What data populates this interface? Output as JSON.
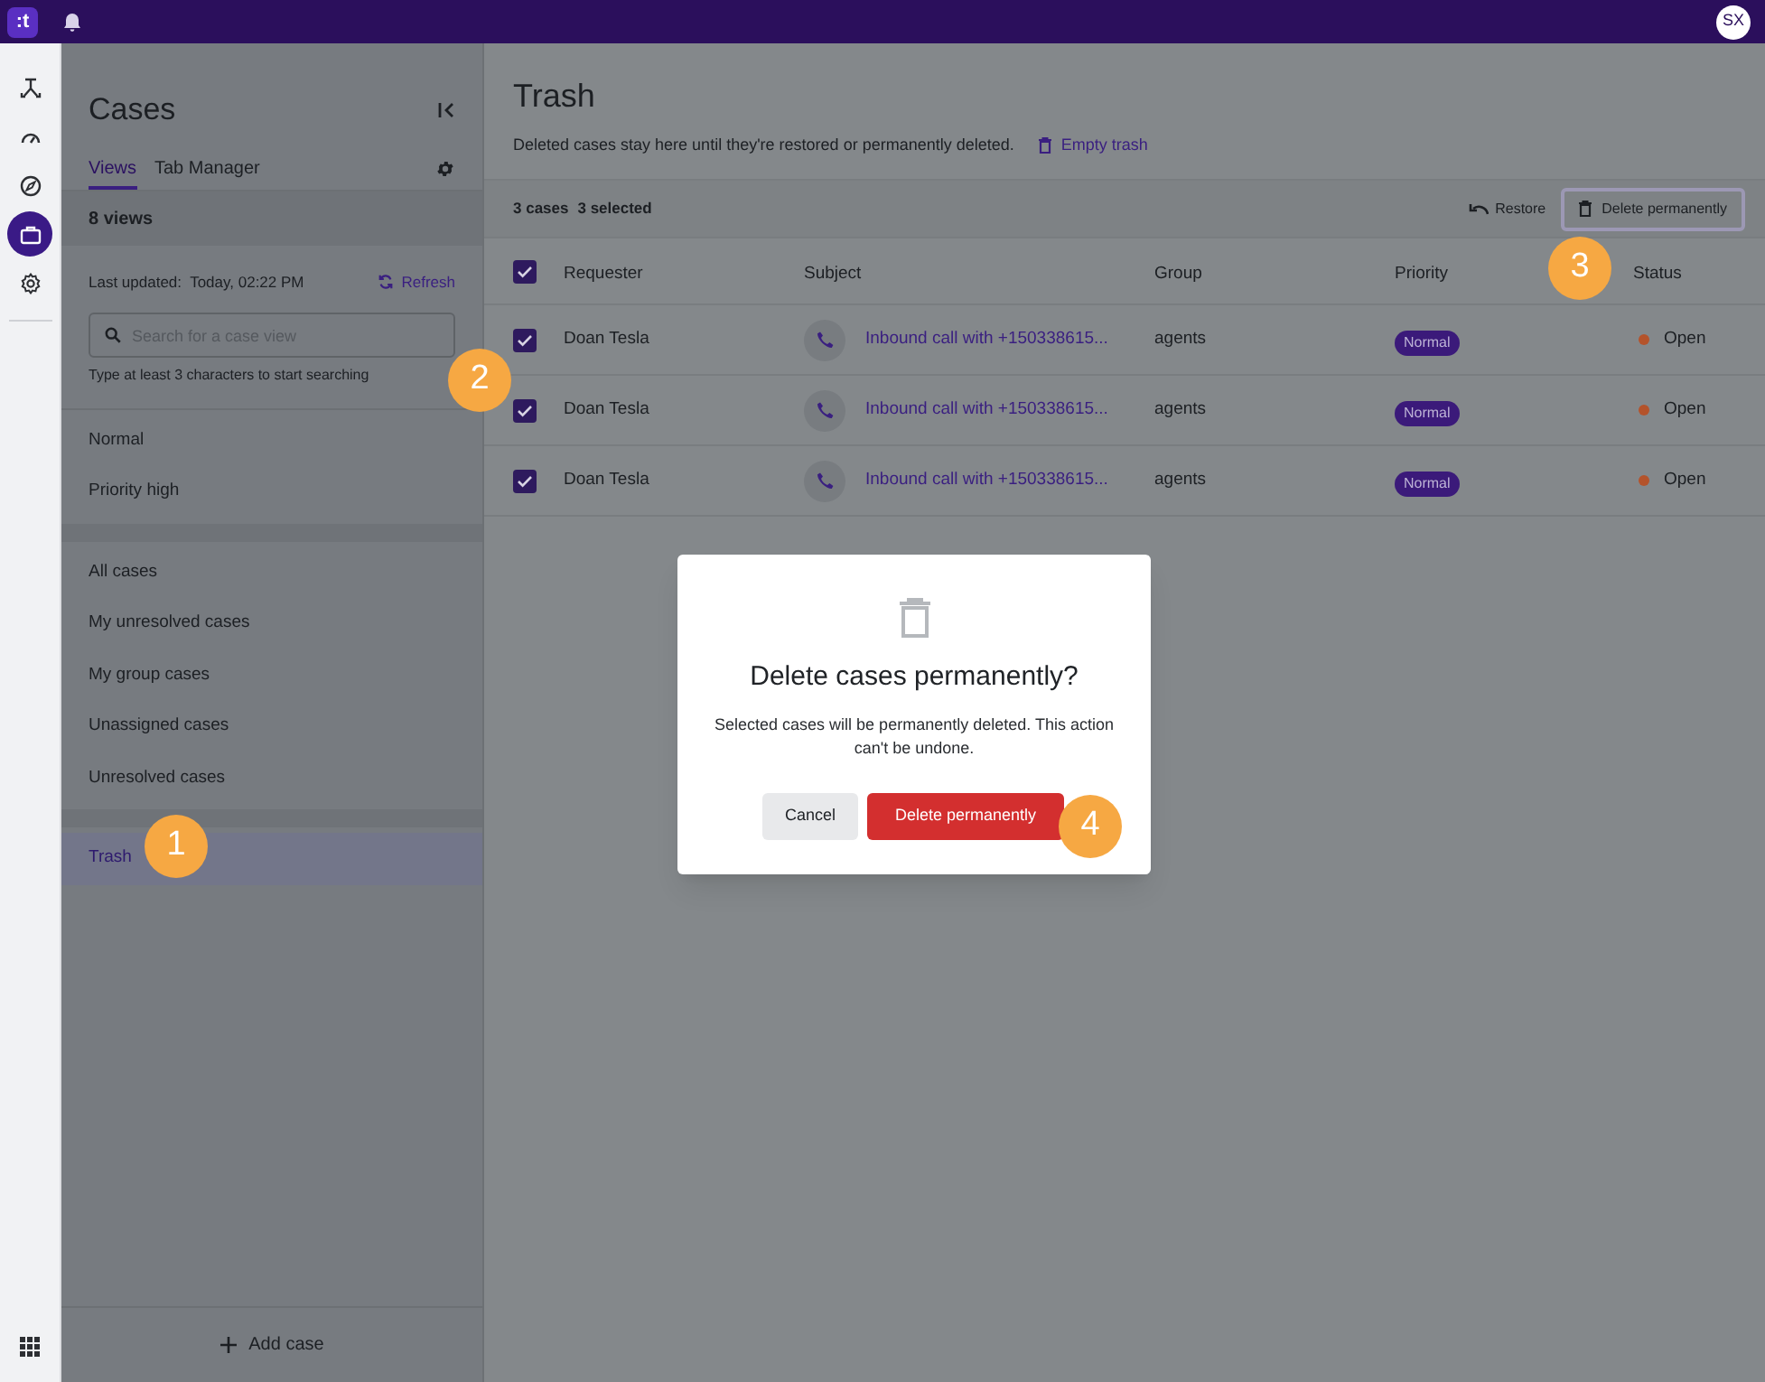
{
  "top_bar": {
    "logo": ":t"
  },
  "rail": [
    {
      "selected": false
    },
    {
      "selected": false
    },
    {
      "selected": false
    },
    {
      "selected": true
    },
    {
      "selected": false
    }
  ],
  "user": {
    "initials": "SX"
  },
  "sidebar": {
    "title": "Cases",
    "tabs": [
      {
        "label": "Views",
        "selected": true
      },
      {
        "label": "Tab Manager",
        "selected": false
      }
    ],
    "count": "8 views",
    "last_updated": "Last updated:  Today, 02:22 PM",
    "refresh": "Refresh",
    "search": {
      "placeholder": "Search for a case view"
    },
    "hint": "Type at least 3 characters to start searching",
    "groups": [
      [
        {
          "label": "Normal",
          "selected": false
        },
        {
          "label": "Priority high",
          "selected": false
        }
      ],
      [
        {
          "label": "All cases",
          "selected": false
        },
        {
          "label": "My unresolved cases",
          "selected": false
        },
        {
          "label": "My group cases",
          "selected": false
        },
        {
          "label": "Unassigned cases",
          "selected": false
        },
        {
          "label": "Unresolved cases",
          "selected": false
        }
      ],
      [
        {
          "label": "Trash",
          "selected": true
        }
      ]
    ],
    "add_button": "Add case"
  },
  "main": {
    "title": "Trash",
    "description": "Deleted cases stay here until they're restored or permanently deleted.",
    "empty_link": "Empty trash",
    "count": "3 cases",
    "selected_count": "3 selected",
    "restore": "Restore",
    "delete": "Delete permanently",
    "table": {
      "all_checked": true,
      "columns": [
        "Requester",
        "Subject",
        "Group",
        "Priority",
        "Status"
      ],
      "rows": [
        {
          "checked": true,
          "requester": "Doan Tesla",
          "subject": "Inbound call with +150338615...",
          "group": "agents",
          "priority": "Normal",
          "status": "Open",
          "color": "#b4532b"
        },
        {
          "checked": true,
          "requester": "Doan Tesla",
          "subject": "Inbound call with +150338615...",
          "group": "agents",
          "priority": "Normal",
          "status": "Open",
          "color": "#b4532b"
        },
        {
          "checked": true,
          "requester": "Doan Tesla",
          "subject": "Inbound call with +150338615...",
          "group": "agents",
          "priority": "Normal",
          "status": "Open",
          "color": "#b4532b"
        }
      ]
    }
  },
  "dialog": {
    "title": "Delete cases permanently?",
    "message": "Selected cases will be permanently deleted. This action can't be undone.",
    "buttons": [
      {
        "label": "Cancel",
        "kind": "secondary"
      },
      {
        "label": "Delete permanently",
        "kind": "danger"
      }
    ]
  },
  "callouts": [
    "1",
    "2",
    "3",
    "4"
  ]
}
